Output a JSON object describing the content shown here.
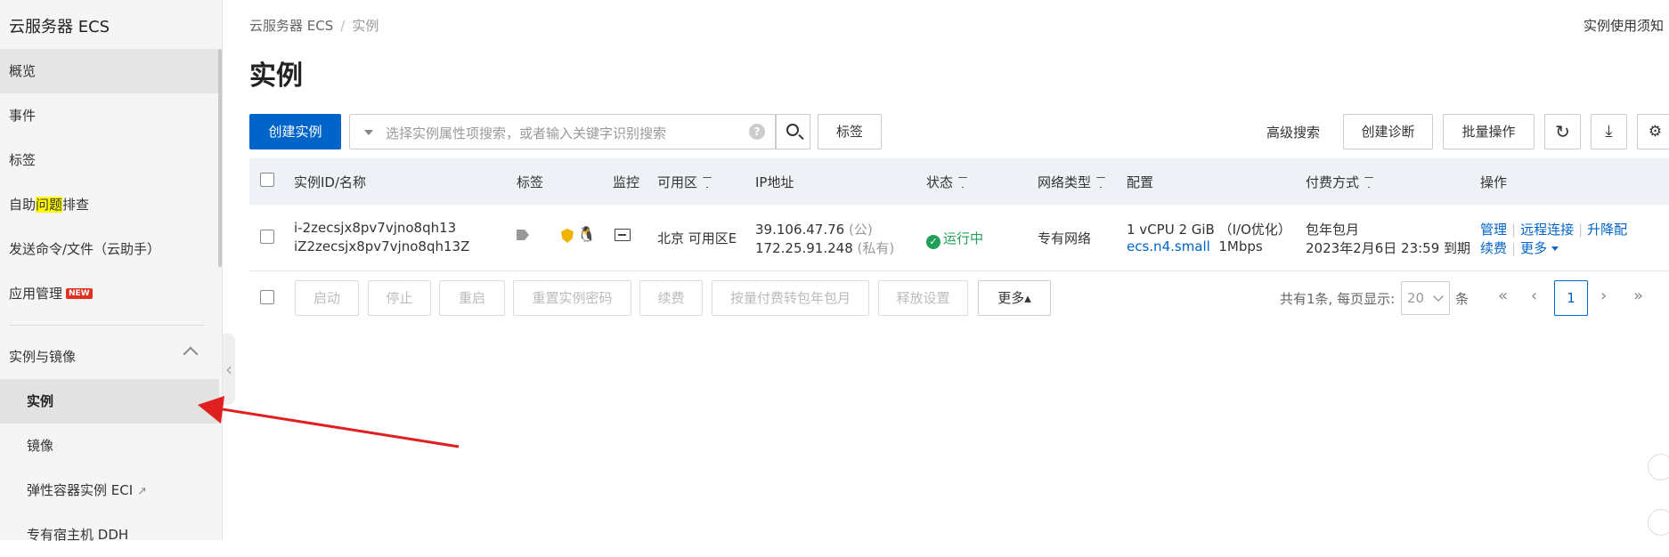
{
  "sidebar": {
    "title": "云服务器 ECS",
    "items": [
      {
        "label": "概览"
      },
      {
        "label": "事件"
      },
      {
        "label": "标签"
      },
      {
        "label_pre": "自助",
        "label_hl": "问题",
        "label_post": "排查"
      },
      {
        "label": "发送命令/文件（云助手）"
      },
      {
        "label": "应用管理",
        "badge": "NEW"
      }
    ],
    "group": {
      "label": "实例与镜像"
    },
    "sub_items": [
      {
        "label": "实例"
      },
      {
        "label": "镜像"
      },
      {
        "label": "弹性容器实例 ECI"
      },
      {
        "label": "专有宿主机 DDH"
      }
    ]
  },
  "breadcrumb": {
    "root": "云服务器 ECS",
    "sep": "/",
    "current": "实例"
  },
  "top_right_link": "实例使用须知",
  "page_title": "实例",
  "toolbar": {
    "create_label": "创建实例",
    "search_placeholder": "选择实例属性项搜索，或者输入关键字识别搜索",
    "help_glyph": "?",
    "tag_label": "标签",
    "advanced_search": "高级搜索",
    "create_diag": "创建诊断",
    "batch_ops": "批量操作"
  },
  "table": {
    "headers": {
      "id_name": "实例ID/名称",
      "tags": "标签",
      "monitor": "监控",
      "zone": "可用区",
      "ip": "IP地址",
      "status": "状态",
      "network": "网络类型",
      "config": "配置",
      "billing": "付费方式",
      "actions": "操作"
    },
    "rows": [
      {
        "id": "i-2zecsjx8pv7vjno8qh13",
        "name": "iZ2zecsjx8pv7vjno8qh13Z",
        "zone": "北京 可用区E",
        "ip_public": "39.106.47.76",
        "ip_public_tag": "(公)",
        "ip_private": "172.25.91.248",
        "ip_private_tag": "(私有)",
        "status": "运行中",
        "network": "专有网络",
        "config_line1": "1 vCPU 2 GiB （I/O优化）",
        "config_type": "ecs.n4.small",
        "config_bw": "1Mbps",
        "billing_line1": "包年包月",
        "billing_line2": "2023年2月6日 23:59 到期",
        "actions": {
          "manage": "管理",
          "remote": "远程连接",
          "upgrade": "升降配",
          "renew": "续费",
          "more": "更多"
        }
      }
    ]
  },
  "footer": {
    "buttons": [
      "启动",
      "停止",
      "重启",
      "重置实例密码",
      "续费",
      "按量付费转包年包月",
      "释放设置"
    ],
    "more_label": "更多▴",
    "total_text": "共有1条, 每页显示:",
    "page_size": "20",
    "page_size_unit": "条",
    "first": "«",
    "prev": "‹",
    "current_page": "1",
    "next": "›",
    "last": "»"
  },
  "colors": {
    "primary": "#0064c8",
    "success": "#1ea05a",
    "arrow": "#e02020"
  }
}
